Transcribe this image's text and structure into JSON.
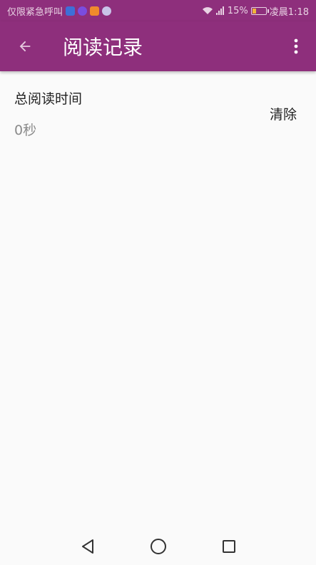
{
  "status_bar": {
    "carrier_text": "仅限紧急呼叫",
    "battery_percent": "15%",
    "time": "凌晨1:18",
    "notification_icons": [
      "shield-app-icon",
      "purple-app-icon",
      "orange-app-icon",
      "k-app-icon"
    ]
  },
  "app_bar": {
    "title": "阅读记录",
    "back_icon": "arrow-left-icon",
    "menu_icon": "more-vert-icon"
  },
  "reading": {
    "total_label": "总阅读时间",
    "total_value": "0秒",
    "clear_label": "清除"
  },
  "nav_bar": {
    "buttons": [
      "back-triangle-icon",
      "home-circle-icon",
      "recents-square-icon"
    ]
  },
  "colors": {
    "primary": "#8e2f7c",
    "background": "#fafafa"
  }
}
